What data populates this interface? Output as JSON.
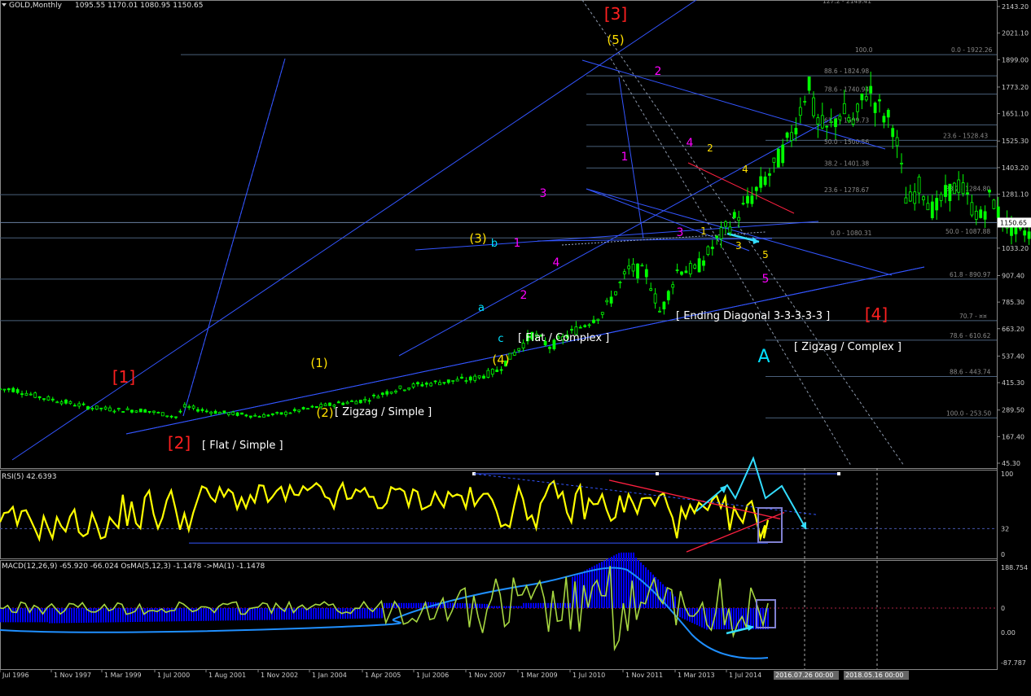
{
  "window": {
    "main_title": "GOLD,Monthly",
    "ohlc": "1095.55 1170.01 1080.95 1150.65",
    "rsi_title": "RSI(5) 42.6393",
    "macd_title": "MACD(12,26,9) -65.920 -66.024  OsMA(5,12,3) -1.1478  ->MA(1) -1.1478"
  },
  "colors": {
    "background": "#000000",
    "grid": "#33333a",
    "candle": "#00ff00",
    "trendline": "#3355ff",
    "fibo": "#4a5f7a",
    "fibo_text": "#8a8a8a",
    "wave_primary": "#ff2020",
    "wave_intermediate": "#ffe000",
    "wave_minor": "#ff00ff",
    "wave_corrective": "#00e0ff",
    "rsi_line": "#ffff00",
    "macd_hist": "#0000ff",
    "macd_signal": "#1f8fff",
    "osma_line": "#a6d640",
    "osma_fill": "#3a4a20",
    "price_marker_bg": "#ffffff",
    "red_line": "#ff2040",
    "cyan_arrow": "#33ddff",
    "box": "#8080d0"
  },
  "chart_data": [
    {
      "type": "candlestick",
      "name": "GOLD Monthly",
      "ylim": [
        45.3,
        2143.2
      ],
      "y_ticks": [
        "2143.20",
        "2021.10",
        "1899.00",
        "1773.20",
        "1651.10",
        "1525.30",
        "1403.20",
        "1281.10",
        "1150.65",
        "1033.20",
        "907.40",
        "785.30",
        "663.20",
        "537.40",
        "415.30",
        "289.50",
        "167.40",
        "45.30"
      ],
      "current_price": "1150.65",
      "x_ticks": [
        "Jul 1996",
        "1 Nov 1997",
        "1 Mar 1999",
        "1 Jul 2000",
        "1 Aug 2001",
        "1 Nov 2002",
        "1 Jan 2004",
        "1 Apr 2005",
        "1 Jul 2006",
        "1 Nov 2007",
        "1 Mar 2009",
        "1 Jul 2010",
        "1 Nov 2011",
        "1 Mar 2013",
        "1 Jul 2014"
      ],
      "x_markers": [
        "2016.07.26 00:00",
        "2018.05.16 00:00"
      ],
      "close_series": [
        [
          "1996-07",
          385
        ],
        [
          "1997-01",
          350
        ],
        [
          "1997-07",
          325
        ],
        [
          "1998-01",
          300
        ],
        [
          "1998-07",
          290
        ],
        [
          "1999-01",
          288
        ],
        [
          "1999-08",
          258
        ],
        [
          "1999-10",
          305
        ],
        [
          "2000-03",
          285
        ],
        [
          "2000-09",
          272
        ],
        [
          "2001-03",
          262
        ],
        [
          "2001-08",
          272
        ],
        [
          "2002-03",
          300
        ],
        [
          "2002-09",
          320
        ],
        [
          "2003-03",
          335
        ],
        [
          "2003-09",
          380
        ],
        [
          "2004-03",
          405
        ],
        [
          "2004-09",
          420
        ],
        [
          "2005-03",
          430
        ],
        [
          "2005-09",
          470
        ],
        [
          "2006-05",
          640
        ],
        [
          "2006-09",
          580
        ],
        [
          "2007-03",
          660
        ],
        [
          "2007-09",
          740
        ],
        [
          "2008-03",
          940
        ],
        [
          "2008-07",
          915
        ],
        [
          "2008-10",
          730
        ],
        [
          "2009-02",
          940
        ],
        [
          "2009-06",
          930
        ],
        [
          "2009-12",
          1100
        ],
        [
          "2010-06",
          1245
        ],
        [
          "2010-12",
          1410
        ],
        [
          "2011-04",
          1560
        ],
        [
          "2011-08",
          1820
        ],
        [
          "2011-09",
          1620
        ],
        [
          "2011-12",
          1565
        ],
        [
          "2012-03",
          1665
        ],
        [
          "2012-06",
          1600
        ],
        [
          "2012-09",
          1775
        ],
        [
          "2012-12",
          1660
        ],
        [
          "2013-03",
          1595
        ],
        [
          "2013-06",
          1230
        ],
        [
          "2013-09",
          1325
        ],
        [
          "2013-12",
          1200
        ],
        [
          "2014-03",
          1285
        ],
        [
          "2014-06",
          1325
        ],
        [
          "2014-09",
          1210
        ],
        [
          "2014-11",
          1170
        ],
        [
          "2015-01",
          1280
        ],
        [
          "2015-03",
          1180
        ],
        [
          "2015-07",
          1095
        ],
        [
          "2015-09",
          1115
        ],
        [
          "2015-11",
          1065
        ],
        [
          "2016-01",
          1118
        ],
        [
          "2016-02",
          1150
        ]
      ],
      "fibonacci_levels": [
        "127.2 - 2149.41",
        "100.0",
        "0.0 - 1922.26",
        "88.6 - 1824.98",
        "78.6 - 1740.94",
        "61.8 - 1599.73",
        "50.0 - 1500.56",
        "38.2 - 1401.38",
        "23.6 - 1278.67",
        "0.0 - 1080.31",
        "23.6 - 1528.43",
        "38.2 - 1284.80",
        "50.0 - 1087.88",
        "61.8 - 890.97",
        "70.7 - ¤¤",
        "78.6 - 610.62",
        "88.6 - 443.74",
        "100.0 - 253.50"
      ],
      "wave_labels": {
        "primary": [
          "[1]",
          "[2]",
          "[3]",
          "[4]"
        ],
        "intermediate": [
          "(1)",
          "(2)",
          "(3)",
          "(4)",
          "(5)"
        ],
        "minor": [
          "1",
          "2",
          "3",
          "4",
          "5"
        ],
        "corrective": [
          "a",
          "b",
          "c",
          "A"
        ],
        "ending_diagonal": [
          "1",
          "2",
          "3",
          "4",
          "5"
        ]
      },
      "annotations": [
        "[ Flat / Simple ]",
        "[ Zigzag / Simple ]",
        "[ Flat / Complex ]",
        "[ Ending Diagonal 3-3-3-3-3 ]",
        "[ Zigzag / Complex ]"
      ]
    },
    {
      "type": "line",
      "name": "RSI(5)",
      "ylim": [
        0,
        100
      ],
      "y_ticks": [
        "100",
        "32",
        "0"
      ],
      "current": 42.6393
    },
    {
      "type": "bar",
      "name": "MACD(12,26,9) / OsMA(5,12,3)",
      "ylim": [
        -87.787,
        188.754
      ],
      "y_ticks": [
        "188.754",
        "0",
        "0.00",
        "-87.787"
      ],
      "macd": -65.92,
      "signal": -66.024,
      "osma": -1.1478
    }
  ]
}
